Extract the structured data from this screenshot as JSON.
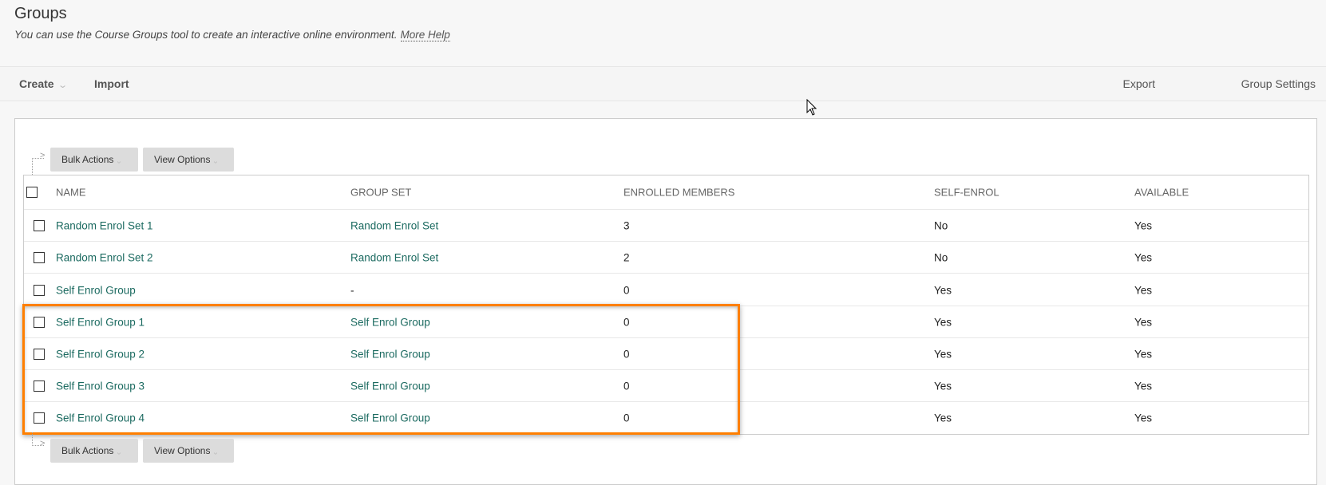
{
  "header": {
    "title": "Groups",
    "description": "You can use the Course Groups tool to create an interactive online environment.",
    "help_link": "More Help"
  },
  "toolbar": {
    "create_label": "Create",
    "import_label": "Import",
    "export_label": "Export",
    "group_settings_label": "Group Settings"
  },
  "action_bar": {
    "bulk_actions_label": "Bulk Actions",
    "view_options_label": "View Options"
  },
  "table": {
    "columns": [
      "NAME",
      "GROUP SET",
      "ENROLLED MEMBERS",
      "SELF-ENROL",
      "AVAILABLE"
    ],
    "rows": [
      {
        "name": "Random Enrol Set 1",
        "group_set": "Random Enrol Set",
        "enrolled": "3",
        "self_enrol": "No",
        "available": "Yes"
      },
      {
        "name": "Random Enrol Set 2",
        "group_set": "Random Enrol Set",
        "enrolled": "2",
        "self_enrol": "No",
        "available": "Yes"
      },
      {
        "name": "Self Enrol Group",
        "group_set": "-",
        "enrolled": "0",
        "self_enrol": "Yes",
        "available": "Yes"
      },
      {
        "name": "Self Enrol Group 1",
        "group_set": "Self Enrol Group",
        "enrolled": "0",
        "self_enrol": "Yes",
        "available": "Yes"
      },
      {
        "name": "Self Enrol Group 2",
        "group_set": "Self Enrol Group",
        "enrolled": "0",
        "self_enrol": "Yes",
        "available": "Yes"
      },
      {
        "name": "Self Enrol Group 3",
        "group_set": "Self Enrol Group",
        "enrolled": "0",
        "self_enrol": "Yes",
        "available": "Yes"
      },
      {
        "name": "Self Enrol Group 4",
        "group_set": "Self Enrol Group",
        "enrolled": "0",
        "self_enrol": "Yes",
        "available": "Yes"
      }
    ]
  },
  "colors": {
    "link": "#1b6a60",
    "highlight": "#ff7f00",
    "button_bg": "#dcdcdc"
  }
}
